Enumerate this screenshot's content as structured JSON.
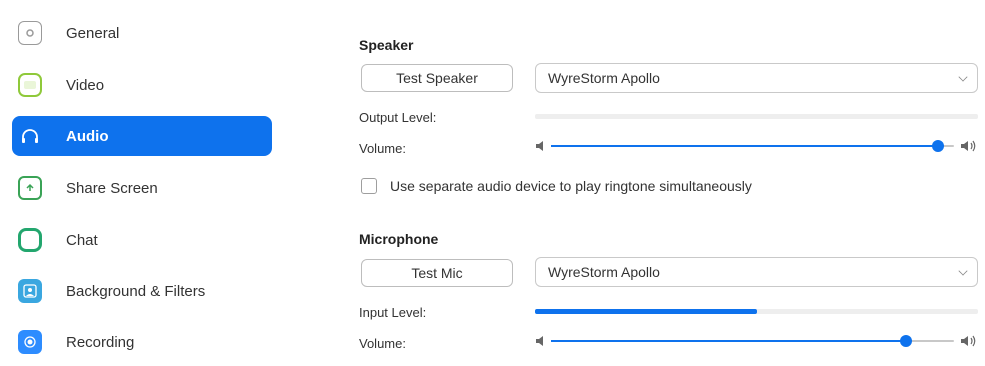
{
  "sidebar": {
    "items": [
      {
        "label": "General",
        "icon": "gear-icon",
        "color": "#8a8a8a",
        "active": false
      },
      {
        "label": "Video",
        "icon": "video-icon",
        "color": "#8fc93a",
        "active": false
      },
      {
        "label": "Audio",
        "icon": "headphones-icon",
        "color": "#ffffff",
        "active": true
      },
      {
        "label": "Share Screen",
        "icon": "share-screen-icon",
        "color": "#3aa356",
        "active": false
      },
      {
        "label": "Chat",
        "icon": "chat-icon",
        "color": "#23a66e",
        "active": false
      },
      {
        "label": "Background & Filters",
        "icon": "background-icon",
        "color": "#3aa7e0",
        "active": false
      },
      {
        "label": "Recording",
        "icon": "recording-icon",
        "color": "#2d8cff",
        "active": false
      }
    ]
  },
  "speaker": {
    "title": "Speaker",
    "test_button": "Test Speaker",
    "device": "WyreStorm Apollo",
    "output_level_label": "Output Level:",
    "output_level": 0,
    "volume_label": "Volume:",
    "volume": 0.96
  },
  "ringtone": {
    "label": "Use separate audio device to play ringtone simultaneously",
    "checked": false
  },
  "microphone": {
    "title": "Microphone",
    "test_button": "Test Mic",
    "device": "WyreStorm Apollo",
    "input_level_label": "Input Level:",
    "input_level": 0.5,
    "volume_label": "Volume:",
    "volume": 0.88
  },
  "colors": {
    "accent": "#0e72ed"
  }
}
